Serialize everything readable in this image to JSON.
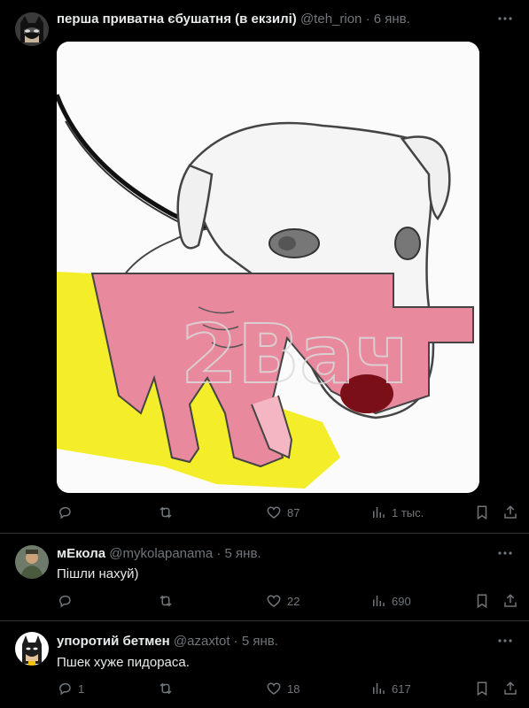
{
  "post": {
    "author_name": "перша приватна єбушатня (в екзилі)",
    "handle": "@teh_rion",
    "dot": "·",
    "date": "6 янв.",
    "watermark": "2Вач",
    "stats": {
      "replies": "",
      "reposts": "",
      "likes": "87",
      "views": "1 тыс."
    }
  },
  "replies": [
    {
      "author_name": "мЕкола",
      "handle": "@mykolapanama",
      "dot": "·",
      "date": "5 янв.",
      "text": "Пішли нахуй)",
      "stats": {
        "replies": "",
        "reposts": "",
        "likes": "22",
        "views": "690"
      }
    },
    {
      "author_name": "упоротий бетмен",
      "handle": "@azaxtot",
      "dot": "·",
      "date": "5 янв.",
      "text": "Пшек хуже пидораса.",
      "stats": {
        "replies": "1",
        "reposts": "",
        "likes": "18",
        "views": "617"
      }
    }
  ],
  "icons": {
    "reply": "reply-icon",
    "repost": "repost-icon",
    "like": "like-icon",
    "views": "views-icon",
    "bookmark": "bookmark-icon",
    "share": "share-icon",
    "more": "more-icon"
  },
  "colors": {
    "background": "#000000",
    "secondary_text": "#71767b",
    "divider": "#2f3336",
    "flag_red": "#e8899e",
    "flag_yellow": "#f4ee2a"
  }
}
